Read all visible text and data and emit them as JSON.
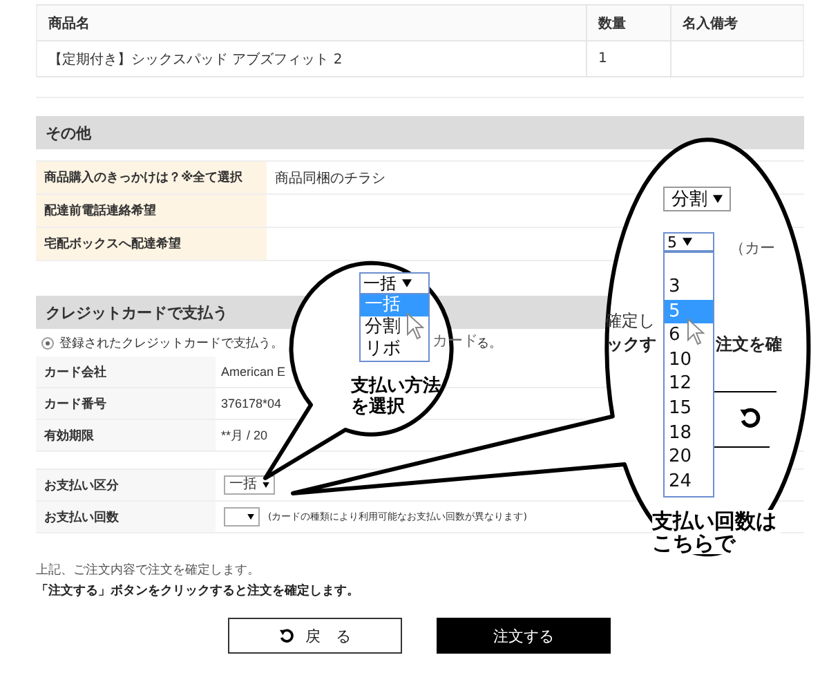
{
  "product_table": {
    "columns": [
      "商品名",
      "数量",
      "名入備考"
    ],
    "rows": [
      {
        "name": "【定期付き】シックスパッド アブズフィット 2",
        "quantity": "1"
      }
    ]
  },
  "other": {
    "title": "その他",
    "rows": [
      {
        "label": "商品購入のきっかけは？※全て選択",
        "value": "商品同梱のチラシ"
      },
      {
        "label": "配達前電話連絡希望"
      },
      {
        "label": "宅配ボックスへ配達希望"
      }
    ]
  },
  "credit": {
    "title": "クレジットカードで支払う",
    "radio": {
      "label": "登録されたクレジットカードで支払う。",
      "selected": true
    },
    "radio_tail": "る。",
    "card_rows": [
      {
        "label": "カード会社",
        "value": "American E"
      },
      {
        "label": "カード番号",
        "value": "376178*04"
      },
      {
        "label": "有効期限",
        "value": "**月 / 20"
      }
    ],
    "payment_type": {
      "label": "お支払い区分",
      "value": "一括"
    },
    "installments": {
      "label": "お支払い回数",
      "note": "(カードの種類により利用可能なお支払い回数が異なります)"
    }
  },
  "notice": [
    "上記、ご注文内容で注文を確定します。",
    "「注文する」ボタンをクリックすると注文を確定します。"
  ],
  "buttons": {
    "back": "戻　る",
    "order": "注文する"
  },
  "callouts": [
    {
      "kind": "method",
      "select": "一括",
      "options": [
        {
          "label": "一括",
          "selected": true
        },
        {
          "label": "分割",
          "selected": false
        },
        {
          "label": "リボ",
          "selected": false
        }
      ],
      "fragments": [
        "カード"
      ],
      "caption": "支払い方法を選択"
    },
    {
      "kind": "count",
      "selects": [
        "分割",
        "5"
      ],
      "fragments": [
        "（カー",
        "確定し",
        "ックす",
        "注文を確"
      ],
      "options": [
        {
          "label": "3",
          "selected": false
        },
        {
          "label": "5",
          "selected": true
        },
        {
          "label": "6",
          "selected": false
        },
        {
          "label": "10",
          "selected": false
        },
        {
          "label": "12",
          "selected": false
        },
        {
          "label": "15",
          "selected": false
        },
        {
          "label": "18",
          "selected": false
        },
        {
          "label": "20",
          "selected": false
        },
        {
          "label": "24",
          "selected": false
        }
      ],
      "caption": "支払い回数はこちらで"
    }
  ]
}
